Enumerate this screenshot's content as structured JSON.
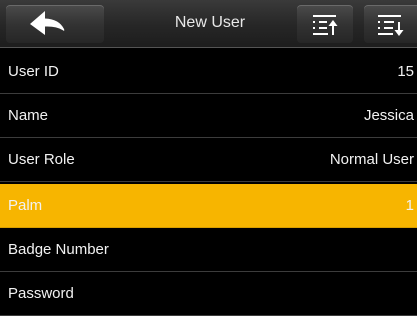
{
  "header": {
    "title": "New User",
    "back_icon": "back-arrow-icon",
    "up_icon": "list-move-up-icon",
    "down_icon": "list-move-down-icon"
  },
  "rows": [
    {
      "label": "User ID",
      "value": "15"
    },
    {
      "label": "Name",
      "value": "Jessica"
    },
    {
      "label": "User Role",
      "value": "Normal User"
    },
    {
      "label": "Palm",
      "value": "1"
    },
    {
      "label": "Badge Number",
      "value": ""
    },
    {
      "label": "Password",
      "value": ""
    }
  ],
  "selected_row": "Palm",
  "colors": {
    "background": "#000000",
    "selected": "#f7b500",
    "text": "#f2f2f2"
  }
}
